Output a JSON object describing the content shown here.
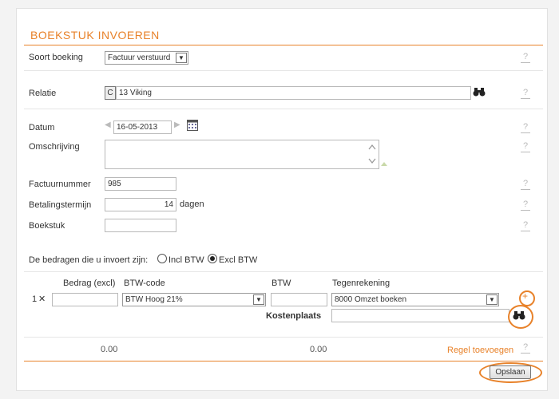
{
  "title": "BOEKSTUK INVOEREN",
  "help_glyph": "?",
  "soort_boeking": {
    "label": "Soort boeking",
    "value": "Factuur verstuurd"
  },
  "relatie": {
    "label": "Relatie",
    "prefix": "C",
    "value": "13 Viking"
  },
  "datum": {
    "label": "Datum",
    "value": "16-05-2013"
  },
  "omschrijving": {
    "label": "Omschrijving",
    "value": ""
  },
  "factuurnummer": {
    "label": "Factuurnummer",
    "value": "985"
  },
  "betalingstermijn": {
    "label": "Betalingstermijn",
    "value": "14",
    "unit": "dagen"
  },
  "boekstuk": {
    "label": "Boekstuk",
    "value": ""
  },
  "bedragen": {
    "prompt": "De bedragen die u invoert zijn:",
    "options": [
      "Incl BTW",
      "Excl BTW"
    ],
    "selected": "Excl BTW"
  },
  "grid": {
    "headers": {
      "bedrag": "Bedrag (excl)",
      "btw_code": "BTW-code",
      "btw": "BTW",
      "tegenrekening": "Tegenrekening"
    },
    "row": {
      "number": "1",
      "remove": "✕",
      "bedrag": "",
      "btw_code": "BTW Hoog 21%",
      "btw": "",
      "tegenrekening": "8000 Omzet boeken"
    },
    "kostenplaats_label": "Kostenplaats",
    "kostenplaats_value": "",
    "add": "+"
  },
  "totals": {
    "bedrag": "0.00",
    "btw": "0.00"
  },
  "regel_toevoegen": "Regel toevoegen",
  "opslaan": "Opslaan",
  "colors": {
    "accent": "#e8822a"
  }
}
